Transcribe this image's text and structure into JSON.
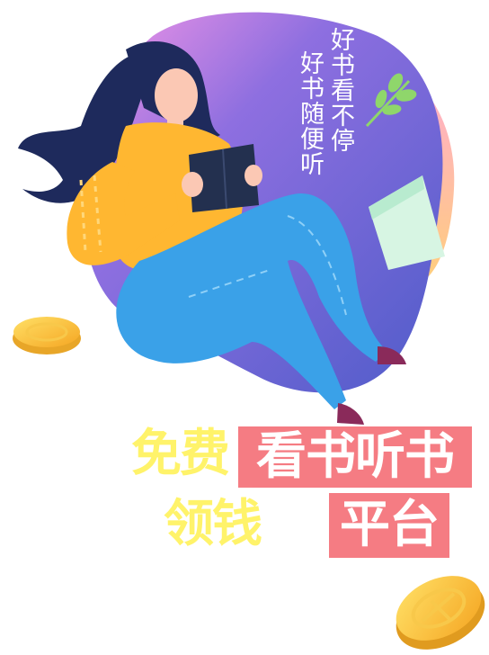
{
  "slogan": {
    "line1": "好书看不停",
    "line2": "好书随便听"
  },
  "headline": {
    "free": "免费",
    "read_listen": "看书听书",
    "earn": "领钱",
    "platform": "平台"
  },
  "colors": {
    "blob_purple": "#5a5fce",
    "blob_pink": "#f28ae0",
    "blob_orange": "#ffc07a",
    "sweater": "#ffb731",
    "jeans": "#3aa1e8",
    "hair": "#1e2a5c",
    "book": "#23304f",
    "coin": "#ffc93c",
    "headline_yellow": "#fff36a",
    "headline_pink": "#f57c83"
  },
  "icons": [
    "leaf-sprig-icon",
    "paper-card-icon",
    "gold-coin-icon"
  ]
}
